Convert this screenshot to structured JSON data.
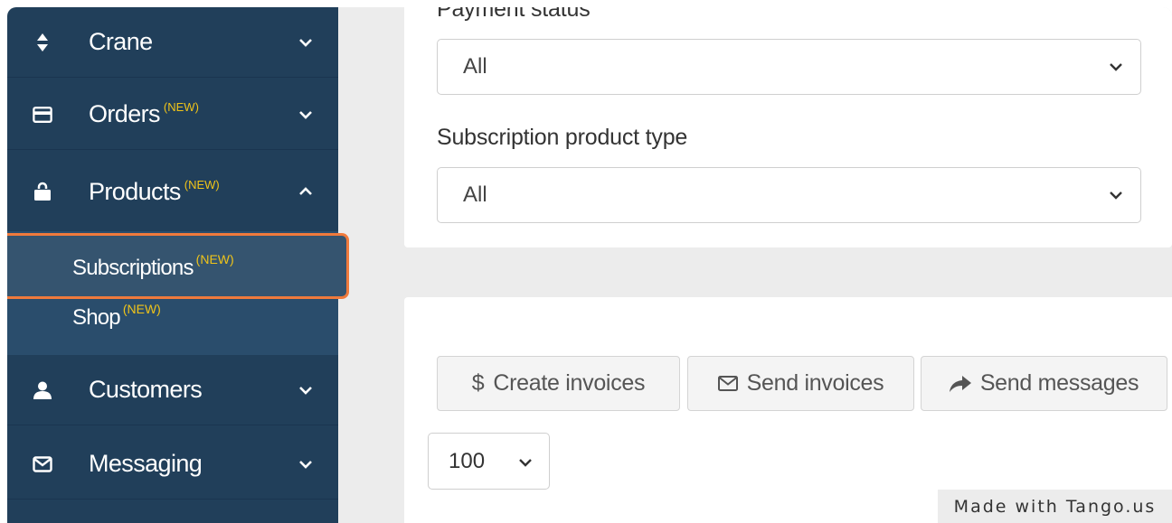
{
  "sidebar": {
    "items": [
      {
        "label": "Crane",
        "badge": "",
        "icon": "sort-icon",
        "chevron": "down"
      },
      {
        "label": "Orders",
        "badge": "(NEW)",
        "icon": "credit-card-icon",
        "chevron": "down"
      },
      {
        "label": "Products",
        "badge": "(NEW)",
        "icon": "shopping-bag-icon",
        "chevron": "up"
      },
      {
        "label": "Customers",
        "badge": "",
        "icon": "user-icon",
        "chevron": "down"
      },
      {
        "label": "Messaging",
        "badge": "",
        "icon": "envelope-icon",
        "chevron": "down"
      }
    ],
    "submenu": [
      {
        "label": "Subscriptions",
        "badge": "(NEW)",
        "active": true
      },
      {
        "label": "Shop",
        "badge": "(NEW)",
        "active": false
      }
    ]
  },
  "filters": {
    "payment_status": {
      "label": "Payment status",
      "value": "All"
    },
    "product_type": {
      "label": "Subscription product type",
      "value": "All"
    }
  },
  "actions": {
    "create_invoices": "Create invoices",
    "send_invoices": "Send invoices",
    "send_messages": "Send messages"
  },
  "page_size": {
    "value": "100"
  },
  "watermark": "Made with Tango.us",
  "colors": {
    "sidebar_bg": "#213f5a",
    "submenu_bg": "#2a4d6c",
    "badge": "#f0c419",
    "highlight": "#f07a3c"
  }
}
